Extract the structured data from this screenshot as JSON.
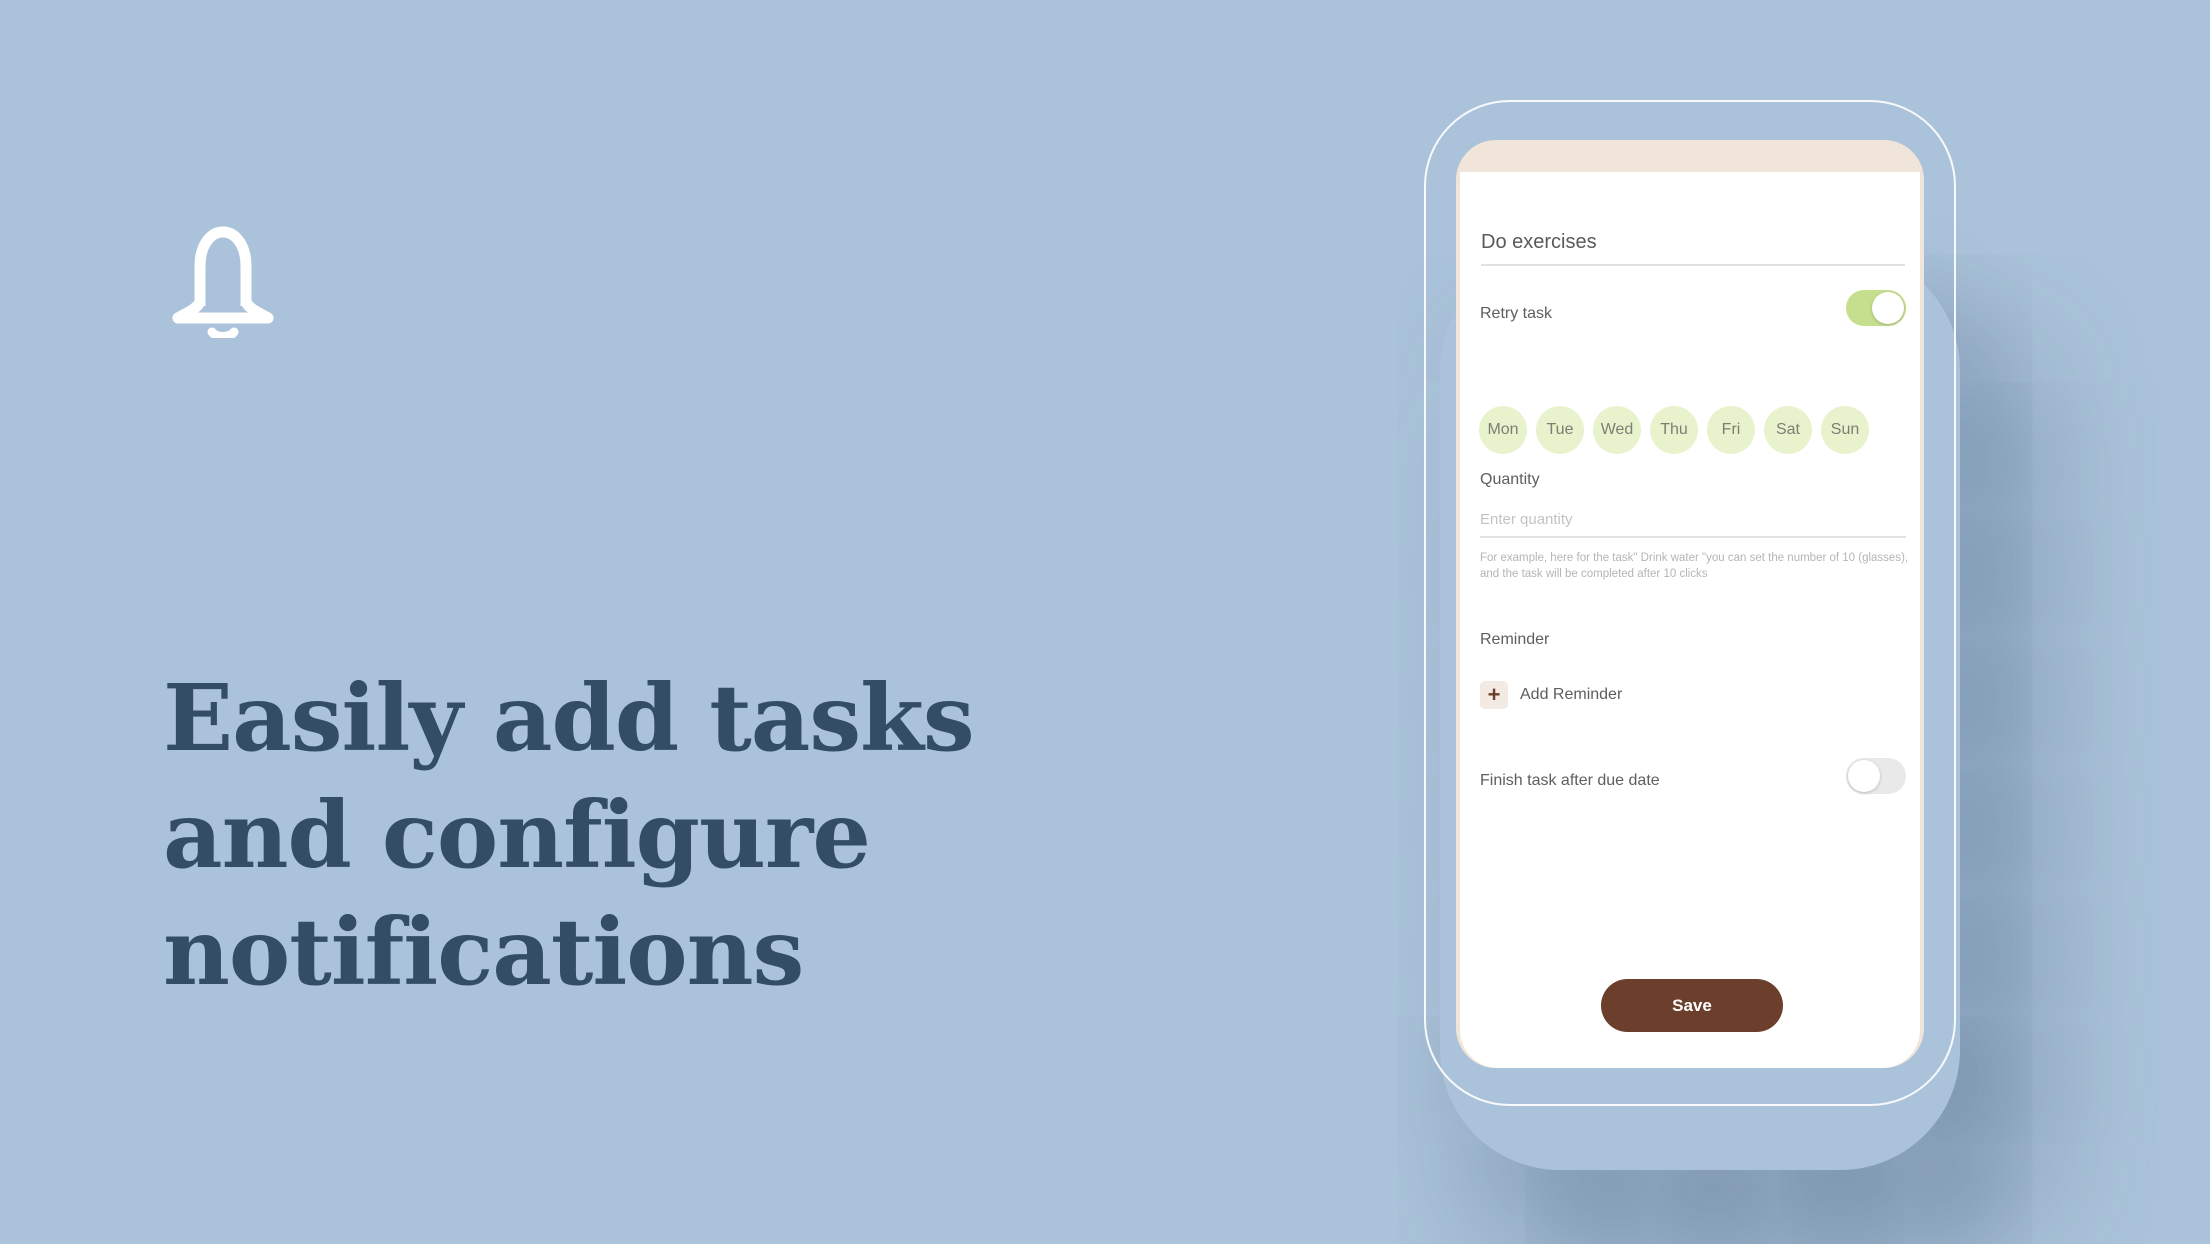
{
  "hero": {
    "icon": "bell-icon",
    "headline_lines": [
      "Easily add tasks",
      "and configure",
      "notifications"
    ]
  },
  "colors": {
    "background": "#aac3da",
    "headline": "#344d66",
    "toggle_on": "#c5df8e",
    "toggle_off": "#e9e9ea",
    "day_chip": "#e8f3cd",
    "save_button": "#6b3f2c",
    "screen_header": "#f1e4d8"
  },
  "form": {
    "task_title": "Do exercises",
    "retry": {
      "label": "Retry task",
      "enabled": true,
      "days": [
        "Mon",
        "Tue",
        "Wed",
        "Thu",
        "Fri",
        "Sat",
        "Sun"
      ]
    },
    "quantity": {
      "label": "Quantity",
      "value": "",
      "placeholder": "Enter quantity",
      "hint": "For example, here for the task\" Drink water \"you can set the number of 10 (glasses), and the task will be completed after 10 clicks"
    },
    "reminder": {
      "label": "Reminder",
      "add_label": "Add Reminder",
      "add_icon": "plus-icon"
    },
    "finish_after_due": {
      "label": "Finish task after due date",
      "enabled": false
    },
    "save_label": "Save"
  }
}
